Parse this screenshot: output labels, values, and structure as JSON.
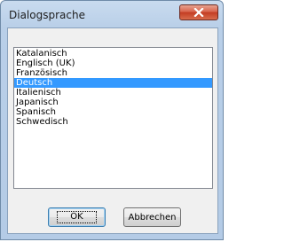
{
  "window": {
    "title": "Dialogsprache"
  },
  "list": {
    "items": [
      {
        "label": "Katalanisch",
        "selected": false
      },
      {
        "label": "Englisch (UK)",
        "selected": false
      },
      {
        "label": "Französisch",
        "selected": false
      },
      {
        "label": "Deutsch",
        "selected": true
      },
      {
        "label": "Italienisch",
        "selected": false
      },
      {
        "label": "Japanisch",
        "selected": false
      },
      {
        "label": "Spanisch",
        "selected": false
      },
      {
        "label": "Schwedisch",
        "selected": false
      }
    ]
  },
  "buttons": {
    "ok_label": "OK",
    "cancel_label": "Abbrechen"
  },
  "icons": {
    "close": "close-icon"
  },
  "colors": {
    "selection": "#3399ff",
    "close_button": "#c33c22"
  }
}
